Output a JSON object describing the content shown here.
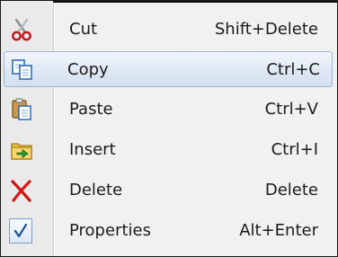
{
  "menu": {
    "items": [
      {
        "label": "Cut",
        "shortcut": "Shift+Delete",
        "icon": "scissors-icon",
        "highlighted": false
      },
      {
        "label": "Copy",
        "shortcut": "Ctrl+C",
        "icon": "copy-icon",
        "highlighted": true
      },
      {
        "label": "Paste",
        "shortcut": "Ctrl+V",
        "icon": "paste-icon",
        "highlighted": false
      },
      {
        "label": "Insert",
        "shortcut": "Ctrl+I",
        "icon": "insert-icon",
        "highlighted": false
      },
      {
        "label": "Delete",
        "shortcut": "Delete",
        "icon": "delete-icon",
        "highlighted": false
      },
      {
        "label": "Properties",
        "shortcut": "Alt+Enter",
        "icon": "checkmark-icon",
        "highlighted": false,
        "checked": true
      }
    ]
  },
  "colors": {
    "highlight_border": "#9fb6d6",
    "highlight_fill": "#dfe8f4",
    "menu_background": "#f1f1f1",
    "delete_red": "#cc1010",
    "check_blue": "#1f4f9a"
  }
}
